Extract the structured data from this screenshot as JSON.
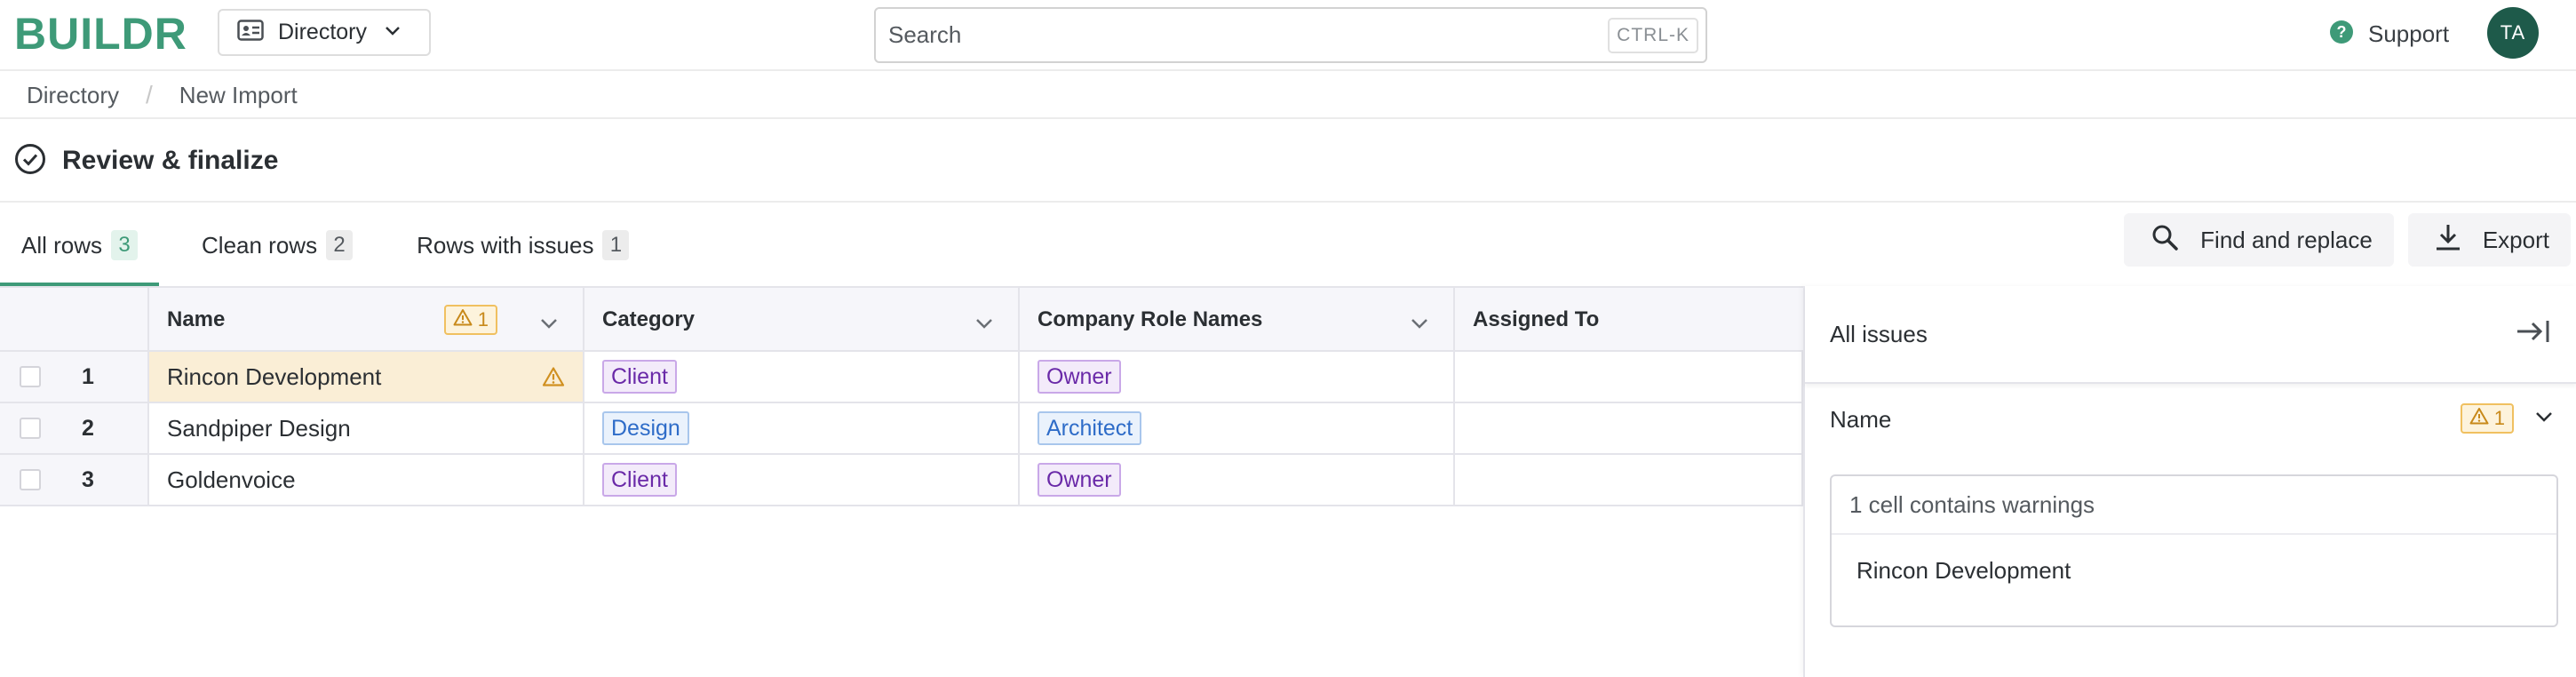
{
  "app": {
    "logo": "BUILDR"
  },
  "header": {
    "directory_label": "Directory",
    "search_placeholder": "Search",
    "search_shortcut": "CTRL-K",
    "support_label": "Support",
    "avatar_initials": "TA"
  },
  "breadcrumb": {
    "items": [
      "Directory",
      "New Import"
    ],
    "separator": "/"
  },
  "page_title": "Review & finalize",
  "tabs": [
    {
      "label": "All rows",
      "count": "3",
      "active": true
    },
    {
      "label": "Clean rows",
      "count": "2",
      "active": false
    },
    {
      "label": "Rows with issues",
      "count": "1",
      "active": false
    }
  ],
  "actions": {
    "find_replace_label": "Find and replace",
    "export_label": "Export"
  },
  "table": {
    "columns": [
      "Name",
      "Category",
      "Company Role Names",
      "Assigned To"
    ],
    "name_warning_count": "1",
    "rows": [
      {
        "index": "1",
        "name": "Rincon Development",
        "name_warning": true,
        "category": "Client",
        "role": "Owner",
        "assigned": ""
      },
      {
        "index": "2",
        "name": "Sandpiper Design",
        "name_warning": false,
        "category": "Design",
        "role": "Architect",
        "assigned": ""
      },
      {
        "index": "3",
        "name": "Goldenvoice",
        "name_warning": false,
        "category": "Client",
        "role": "Owner",
        "assigned": ""
      }
    ]
  },
  "issues_panel": {
    "title": "All issues",
    "section_title": "Name",
    "section_warning_count": "1",
    "summary": "1 cell contains warnings",
    "items": [
      "Rincon Development"
    ]
  },
  "colors": {
    "brand": "#3e9a78",
    "avatar_bg": "#1e5a4a",
    "warning": "#c8891a",
    "warning_bg": "#faeed6",
    "tag_purple": "#6a2aa8",
    "tag_blue": "#2e6cc8"
  },
  "icons": {
    "directory": "contact-card-icon",
    "support": "help-circle-icon",
    "title": "check-circle-icon",
    "find": "search-icon",
    "export": "download-icon",
    "collapse": "collapse-right-icon",
    "warning": "warning-triangle-icon",
    "dropdown": "chevron-down-icon"
  }
}
